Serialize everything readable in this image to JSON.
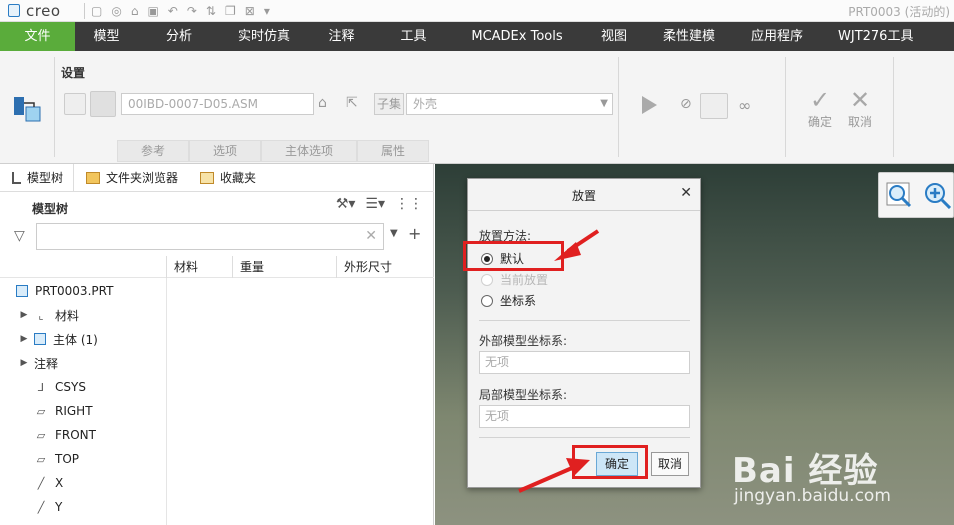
{
  "app": {
    "logo_text": "creo",
    "window_title": "PRT0003 (活动的)"
  },
  "menu": [
    {
      "label": "文件",
      "active": true
    },
    {
      "label": "模型"
    },
    {
      "label": "分析"
    },
    {
      "label": "实时仿真"
    },
    {
      "label": "注释"
    },
    {
      "label": "工具"
    },
    {
      "label": "MCADEx Tools"
    },
    {
      "label": "视图"
    },
    {
      "label": "柔性建模"
    },
    {
      "label": "应用程序"
    },
    {
      "label": "WJT276工具"
    }
  ],
  "ribbon": {
    "setting_label": "设置",
    "asm_value": "00IBD-0007-D05.ASM",
    "subset_label": "子集",
    "shell_value": "外壳",
    "tabs": [
      "参考",
      "选项",
      "主体选项",
      "属性"
    ],
    "ok_label": "确定",
    "cancel_label": "取消"
  },
  "panel": {
    "tabs": [
      {
        "label": "模型树",
        "icon": "model-tree-icon"
      },
      {
        "label": "文件夹浏览器",
        "icon": "folder-browser-icon"
      },
      {
        "label": "收藏夹",
        "icon": "favorites-icon"
      }
    ],
    "tree_title": "模型树",
    "columns": [
      "材料",
      "重量",
      "外形尺寸"
    ],
    "items": [
      {
        "label": "PRT0003.PRT",
        "icon": "part-icon"
      },
      {
        "label": "材料",
        "icon": "material-icon"
      },
      {
        "label": "主体 (1)",
        "icon": "body-icon"
      },
      {
        "label": "注释",
        "icon": "annotation-icon"
      },
      {
        "label": "CSYS",
        "icon": "csys-icon"
      },
      {
        "label": "RIGHT",
        "icon": "datum-plane-icon"
      },
      {
        "label": "FRONT",
        "icon": "datum-plane-icon"
      },
      {
        "label": "TOP",
        "icon": "datum-plane-icon"
      },
      {
        "label": "X",
        "icon": "datum-axis-icon"
      },
      {
        "label": "Y",
        "icon": "datum-axis-icon"
      }
    ]
  },
  "dialog": {
    "title": "放置",
    "method_label": "放置方法:",
    "options": [
      {
        "label": "默认",
        "selected": true,
        "disabled": false
      },
      {
        "label": "当前放置",
        "selected": false,
        "disabled": true
      },
      {
        "label": "坐标系",
        "selected": false,
        "disabled": false
      }
    ],
    "external_label": "外部模型坐标系:",
    "external_value": "无项",
    "local_label": "局部模型坐标系:",
    "local_value": "无项",
    "ok_label": "确定",
    "cancel_label": "取消"
  },
  "watermark": {
    "brand": "Bai 经验",
    "url": "jingyan.baidu.com"
  },
  "colors": {
    "menu_bg": "#3a3a3a",
    "file_tab": "#5aac3b",
    "highlight": "#e02020",
    "ok_button": "#cde6f7"
  }
}
